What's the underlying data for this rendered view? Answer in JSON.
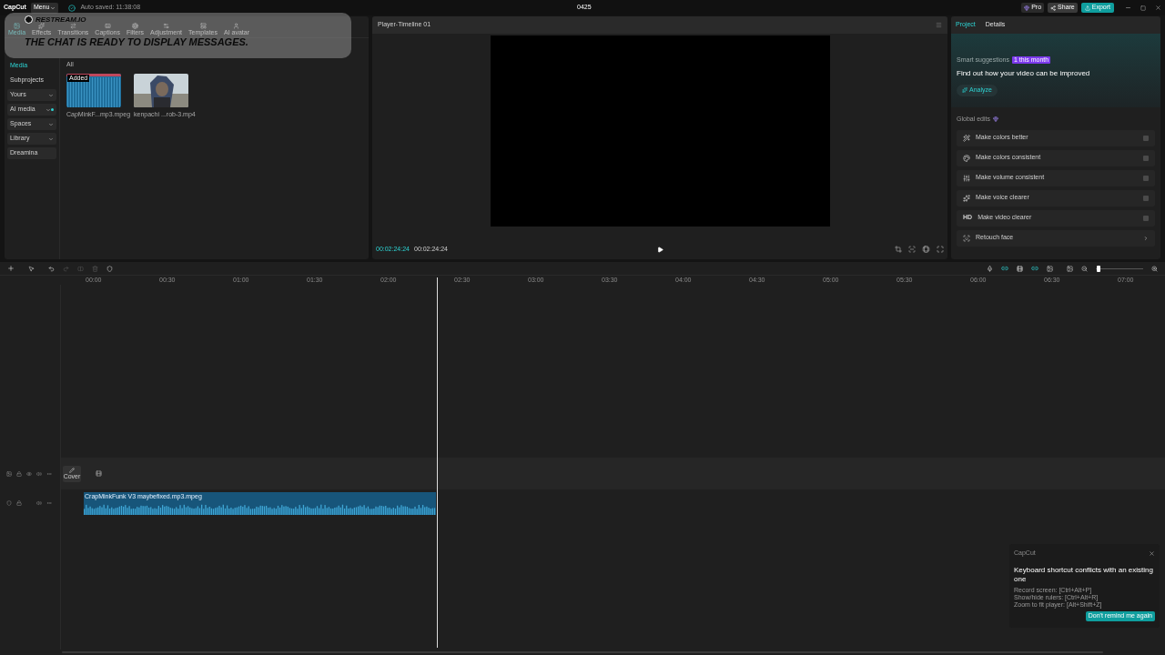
{
  "app": {
    "name": "CapCut",
    "menu": "Menu",
    "autosave": "Auto saved: 11:38:08",
    "project_title": "0425",
    "pro": "Pro",
    "share": "Share",
    "export": "Export"
  },
  "media_tabs": [
    {
      "label": "Media",
      "selected": true
    },
    {
      "label": "Effects",
      "selected": false
    },
    {
      "label": "Transitions",
      "selected": false
    },
    {
      "label": "Captions",
      "selected": false
    },
    {
      "label": "Filters",
      "selected": false
    },
    {
      "label": "Adjustment",
      "selected": false
    },
    {
      "label": "Templates",
      "selected": false
    },
    {
      "label": "AI avatar",
      "selected": false
    }
  ],
  "sidebar": [
    {
      "label": "Media",
      "kind": "link",
      "selected": true
    },
    {
      "label": "Subprojects",
      "kind": "link",
      "selected": false
    },
    {
      "label": "Yours",
      "kind": "dropdown",
      "selected": false
    },
    {
      "label": "AI media",
      "kind": "new",
      "selected": false
    },
    {
      "label": "Spaces",
      "kind": "dropdown",
      "selected": false
    },
    {
      "label": "Library",
      "kind": "dropdown",
      "selected": false
    },
    {
      "label": "Dreamina",
      "kind": "button",
      "selected": false
    }
  ],
  "media_filter": "All",
  "media_items": [
    {
      "name": "CapMinkF...mp3.mpeg",
      "kind": "audio",
      "badge": "Added"
    },
    {
      "name": "kenpachi ...rob-3.mp4",
      "kind": "video"
    }
  ],
  "player": {
    "title": "Player-Timeline 01",
    "current_time": "00:02:24:24",
    "total_time": "00:02:24:24"
  },
  "details": {
    "tabs": [
      {
        "label": "Project",
        "selected": true
      },
      {
        "label": "Details",
        "selected": false
      }
    ],
    "smart_title": "Smart suggestions",
    "smart_badge": "1 this month",
    "smart_heading": "Find out how your video can be improved",
    "analyze": "Analyze",
    "global_edits": "Global edits",
    "edits": [
      {
        "label": "Make colors better",
        "kind": "toggle"
      },
      {
        "label": "Make colors consistent",
        "kind": "toggle"
      },
      {
        "label": "Make volume consistent",
        "kind": "toggle"
      },
      {
        "label": "Make voice clearer",
        "kind": "toggle"
      },
      {
        "label": "Make video clearer",
        "kind": "toggle",
        "tag": "HD"
      },
      {
        "label": "Retouch face",
        "kind": "link"
      }
    ]
  },
  "timeline": {
    "ticks": [
      "00:00",
      "00:30",
      "01:00",
      "01:30",
      "02:00",
      "02:30",
      "03:00",
      "03:30",
      "04:00",
      "04:30",
      "05:00",
      "05:30",
      "06:00",
      "06:30",
      "07:00"
    ],
    "cover": "Cover",
    "clip": "CrapMinkFunk V3 maybefixed.mp3.mpeg",
    "zoom": {
      "level": 0.05
    }
  },
  "overlay": {
    "brand": "RESTREAM.IO",
    "message": "THE CHAT IS READY TO DISPLAY MESSAGES."
  },
  "notice": {
    "app": "CapCut",
    "title": "Keyboard shortcut conflicts with an existing one",
    "lines": [
      "Record screen: [Ctrl+Alt+P]",
      "Show/hide rulers: [Ctrl+Alt+R]",
      "Zoom to fit player: [Alt+Shift+Z]"
    ],
    "button": "Don't remind me again"
  }
}
